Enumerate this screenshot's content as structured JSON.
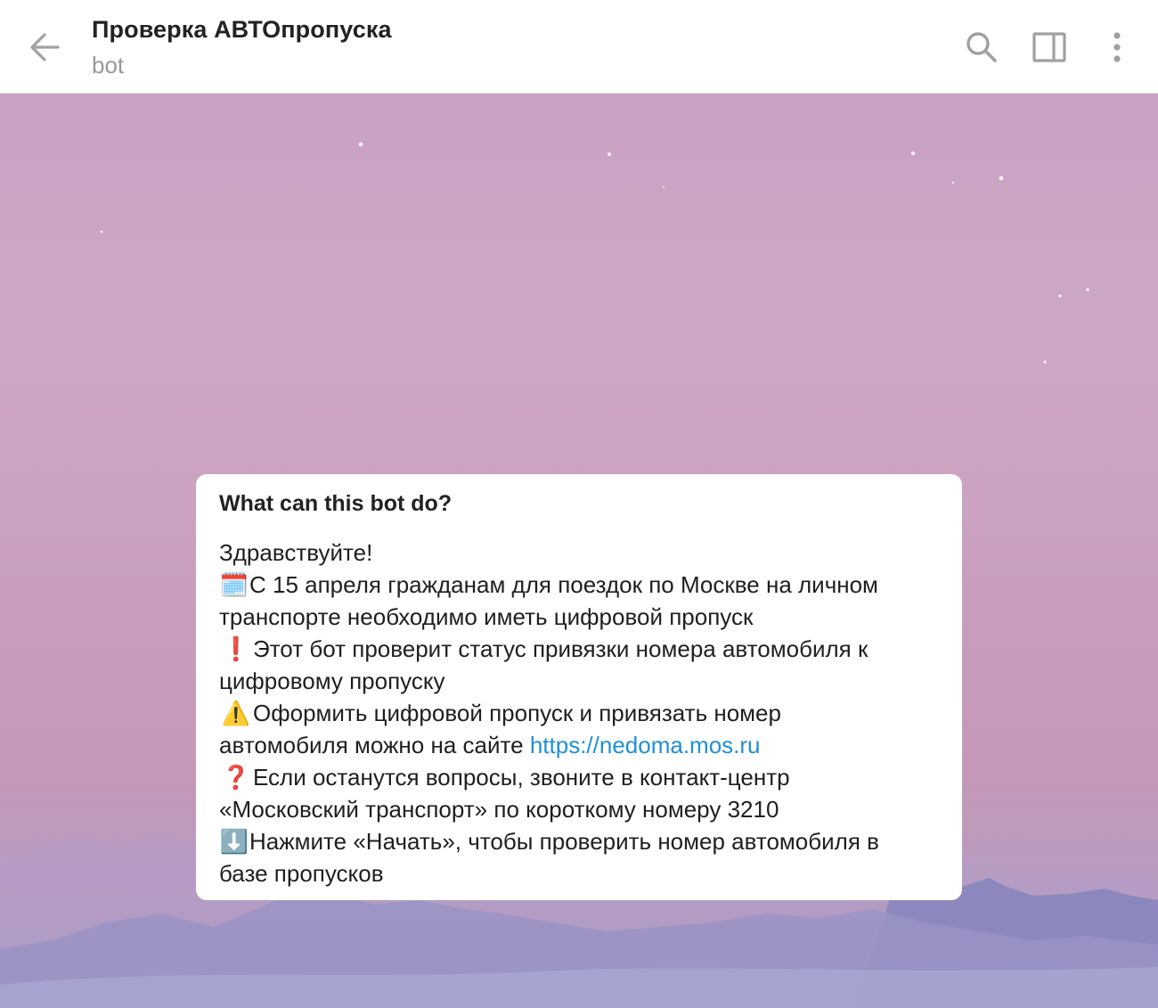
{
  "header": {
    "title": "Проверка АВТОпропуска",
    "subtitle": "bot",
    "icons": {
      "back": "arrow-left-icon",
      "search": "search-icon",
      "panel": "sidebar-toggle-icon",
      "menu": "more-vertical-icon"
    }
  },
  "bubble": {
    "title": "What can this bot do?",
    "greeting": "Здравствуйте!",
    "line1_emoji": "🗓️",
    "line1_text": "С 15 апреля гражданам для поездок по Москве на личном",
    "line1_cont": "транспорте необходимо иметь цифровой пропуск",
    "line2_emoji": "❗",
    "line2_text": "Этот бот проверит статус привязки номера автомобиля к",
    "line2_cont": "цифровому пропуску",
    "line3_emoji": "⚠️",
    "line3_text": "Оформить цифровой пропуск и привязать номер",
    "line3_cont": "автомобиля можно на сайте",
    "line3_link": "https://nedoma.mos.ru",
    "line4_emoji": "❓",
    "line4_text": "Если останутся вопросы, звоните в контакт-центр",
    "line4_cont": "«Московский транспорт» по короткому номеру 3210",
    "line5_emoji": "⬇️",
    "line5_text": "Нажмите «Начать», чтобы проверить номер автомобиля в",
    "line5_cont": "базе пропусков"
  },
  "colors": {
    "accent_link": "#1f8fd8",
    "header_bg": "#ffffff",
    "icon_gray": "#a0a0a0",
    "wallpaper_top": "#c9a2c4",
    "wallpaper_bottom": "#a19fc8"
  }
}
